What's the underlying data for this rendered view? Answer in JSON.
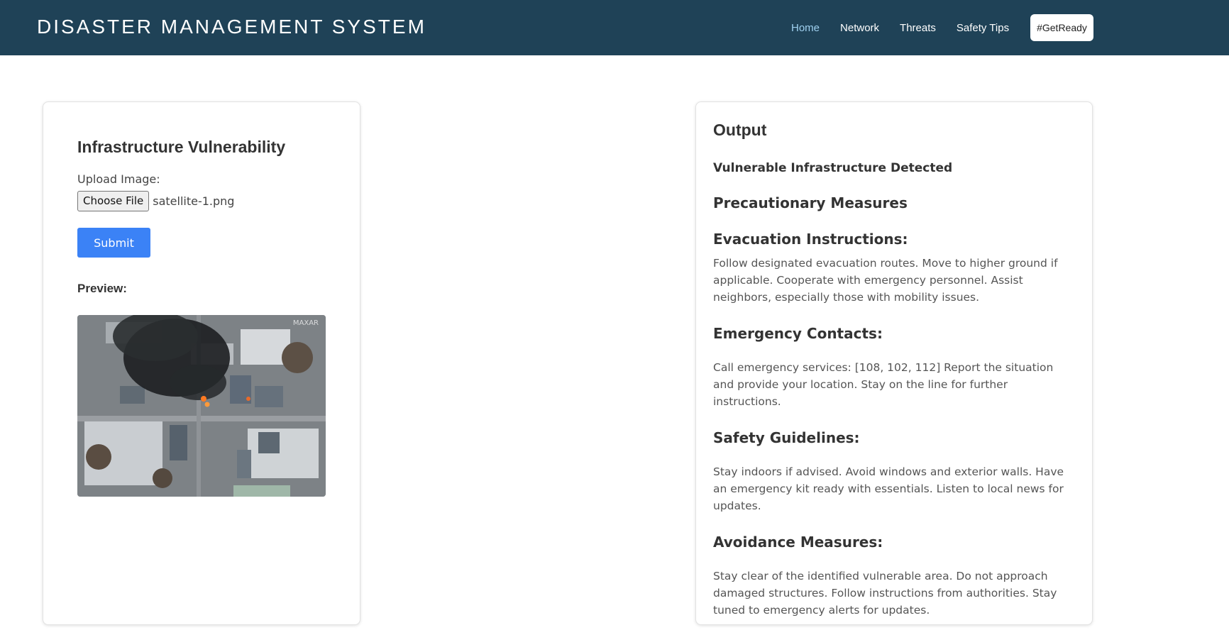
{
  "nav": {
    "brand": "DISASTER MANAGEMENT SYSTEM",
    "links": [
      "Home",
      "Network",
      "Threats",
      "Safety Tips"
    ],
    "cta": "#GetReady"
  },
  "left": {
    "title": "Infrastructure Vulnerability",
    "upload_label": "Upload Image:",
    "choose_file": "Choose File",
    "file_name": "satellite-1.png",
    "submit": "Submit",
    "preview_label": "Preview:",
    "watermark": "MAXAR"
  },
  "output": {
    "title": "Output",
    "detected": "Vulnerable Infrastructure Detected",
    "precautionary": "Precautionary Measures",
    "evac_title": "Evacuation Instructions:",
    "evac_text": "Follow designated evacuation routes. Move to higher ground if applicable. Cooperate with emergency personnel. Assist neighbors, especially those with mobility issues.",
    "contacts_title": "Emergency Contacts:",
    "contacts_text": "Call emergency services: [108, 102, 112] Report the situation and provide your location. Stay on the line for further instructions.",
    "safety_title": "Safety Guidelines:",
    "safety_text": "Stay indoors if advised. Avoid windows and exterior walls. Have an emergency kit ready with essentials. Listen to local news for updates.",
    "avoid_title": "Avoidance Measures:",
    "avoid_text": "Stay clear of the identified vulnerable area. Do not approach damaged structures. Follow instructions from authorities. Stay tuned to emergency alerts for updates."
  },
  "colors": {
    "navbar": "#1f4257",
    "active_link": "#9fd0ef",
    "submit": "#3b82f6"
  }
}
